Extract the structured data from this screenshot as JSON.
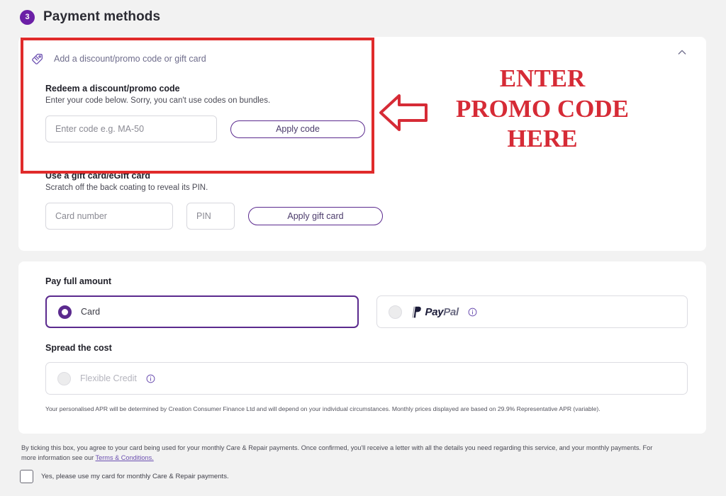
{
  "step": {
    "number": "3",
    "title": "Payment methods"
  },
  "promo_card": {
    "accordion": {
      "icon": "discount-tag-icon",
      "label": "Add a discount/promo code or gift card",
      "toggle_icon": "chevron-up-icon"
    },
    "promo": {
      "title": "Redeem a discount/promo code",
      "subtitle": "Enter your code below. Sorry, you can't use codes on bundles.",
      "input_placeholder": "Enter code e.g. MA-50",
      "input_value": "",
      "button_label": "Apply code"
    },
    "giftcard": {
      "title": "Use a gift card/eGift card",
      "subtitle": "Scratch off the back coating to reveal its PIN.",
      "card_number_placeholder": "Card number",
      "card_number_value": "",
      "pin_placeholder": "PIN",
      "pin_value": "",
      "button_label": "Apply gift card"
    }
  },
  "payment_card": {
    "pay_full": {
      "title": "Pay full amount",
      "options": [
        {
          "label": "Card",
          "selected": true,
          "icon": "radio-selected-icon"
        },
        {
          "label": "PayPal",
          "selected": false,
          "icon": "paypal-logo-icon",
          "info_icon": "info-icon"
        }
      ]
    },
    "spread": {
      "title": "Spread the cost",
      "options": [
        {
          "label": "Flexible Credit",
          "selected": false,
          "disabled": true,
          "info_icon": "info-icon"
        }
      ],
      "apr_note": "Your personalised APR will be determined by Creation Consumer Finance Ltd and will depend on your individual circumstances. Monthly prices displayed are based on 29.9% Representative APR (variable)."
    }
  },
  "footer": {
    "disclaimer_part1": "By ticking this box, you agree to your card being used for your monthly Care & Repair payments. Once confirmed, you'll receive a letter with all the details you need regarding this service, and your monthly payments. For more information see our ",
    "terms_link": "Terms & Conditions.",
    "consent_label": "Yes, please use my card for monthly Care & Repair payments.",
    "consent_checked": false
  },
  "annotation": {
    "text": "ENTER\nPROMO CODE\nHERE",
    "color": "#d62b36",
    "box_color": "#e02b2b",
    "arrow": "left-arrow-annotation"
  },
  "colors": {
    "brand_purple": "#5b2a8e",
    "badge_purple": "#6b1fa6",
    "page_background": "#f2f2f2",
    "card_background": "#ffffff",
    "annotation_red": "#d62b36"
  }
}
